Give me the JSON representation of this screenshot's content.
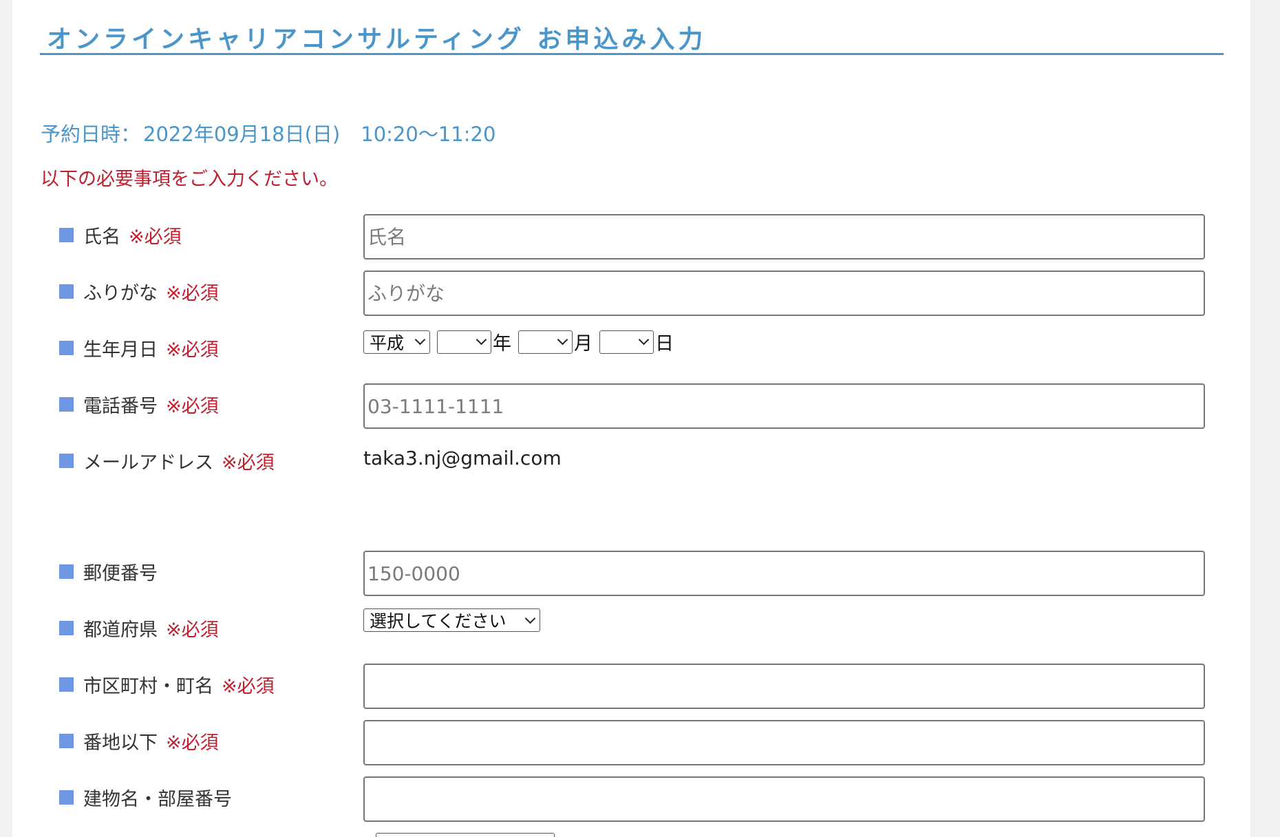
{
  "header": {
    "title": "オンラインキャリアコンサルティング お申込み入力"
  },
  "reservation": {
    "label": "予約日時：",
    "date": "2022年09月18日(日)",
    "time": "10:20〜11:20"
  },
  "notice": "以下の必要事項をご入力ください。",
  "required_mark": "※必須",
  "form": {
    "name": {
      "label": "氏名",
      "placeholder": "氏名",
      "value": ""
    },
    "furigana": {
      "label": "ふりがな",
      "placeholder": "ふりがな",
      "value": ""
    },
    "birthdate": {
      "label": "生年月日",
      "era": "平成",
      "year": "",
      "month": "",
      "day": "",
      "year_unit": "年",
      "month_unit": "月",
      "day_unit": "日"
    },
    "phone": {
      "label": "電話番号",
      "placeholder": "03-1111-1111",
      "value": ""
    },
    "email": {
      "label": "メールアドレス",
      "value": "taka3.nj@gmail.com"
    },
    "postal": {
      "label": "郵便番号",
      "placeholder": "150-0000",
      "value": ""
    },
    "prefecture": {
      "label": "都道府県",
      "selected": "選択してください"
    },
    "city": {
      "label": "市区町村・町名",
      "value": ""
    },
    "street": {
      "label": "番地以下",
      "value": ""
    },
    "building": {
      "label": "建物名・部屋番号",
      "value": ""
    }
  },
  "colors": {
    "accent_blue": "#4a95c9",
    "required_red": "#c0202e",
    "bullet_blue": "#6f96e2"
  }
}
